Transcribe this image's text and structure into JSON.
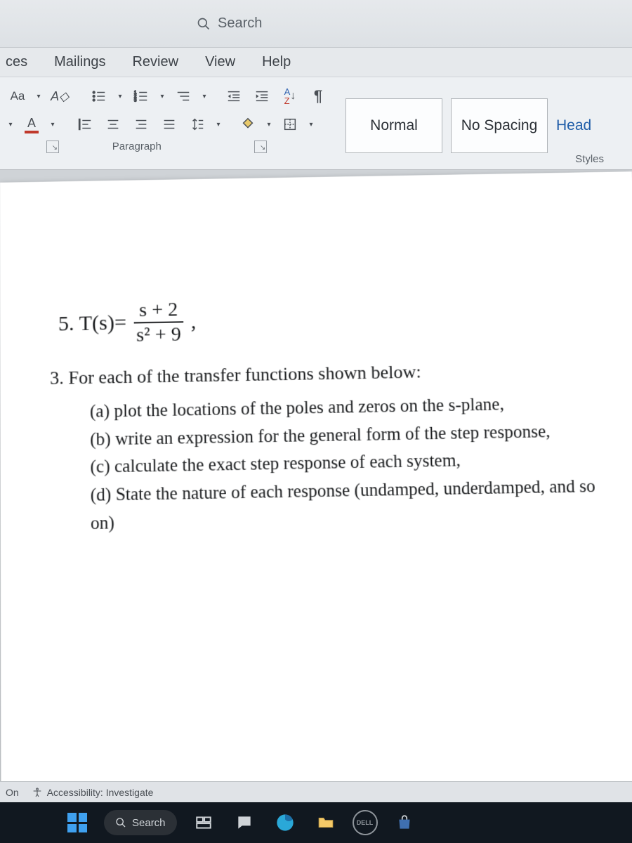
{
  "titlebar": {
    "search_placeholder": "Search"
  },
  "tabs": {
    "t0": "ces",
    "t1": "Mailings",
    "t2": "Review",
    "t3": "View",
    "t4": "Help"
  },
  "ribbon": {
    "paragraph_label": "Paragraph",
    "styles_label": "Styles",
    "sort_label": "A↓Z"
  },
  "styles": {
    "normal": "Normal",
    "nospacing": "No Spacing",
    "heading": "Head"
  },
  "document": {
    "eq_prefix": "5. T(s)=",
    "eq_num": "s + 2",
    "eq_den": "s² + 9",
    "eq_comma": ",",
    "q3": "3. For each of the transfer functions shown below:",
    "a": "(a)  plot the locations of the poles and zeros on the s-plane,",
    "b": "(b)  write an expression for the general form of the step response,",
    "c": "(c)  calculate the exact step response of each system,",
    "d": "(d)  State the nature of each response (undamped, underdamped, and so on)"
  },
  "statusbar": {
    "focus": "On",
    "accessibility": "Accessibility: Investigate"
  },
  "taskbar": {
    "search": "Search",
    "dell": "DELL"
  }
}
